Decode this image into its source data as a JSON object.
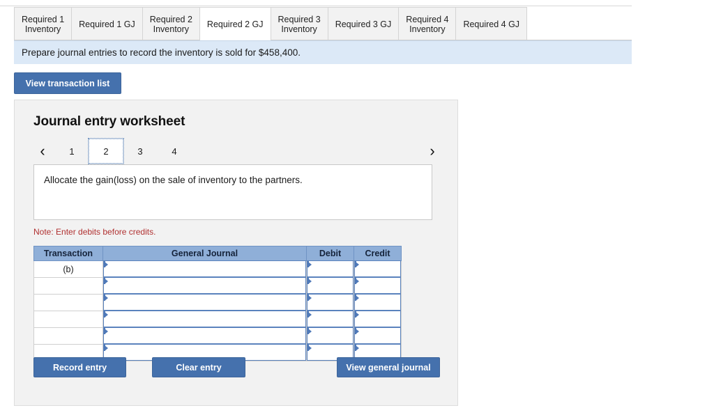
{
  "tabs": [
    {
      "line1": "Required 1",
      "line2": "Inventory",
      "active": false
    },
    {
      "line1": "Required 1 GJ",
      "line2": "",
      "active": false
    },
    {
      "line1": "Required 2",
      "line2": "Inventory",
      "active": false
    },
    {
      "line1": "Required 2 GJ",
      "line2": "",
      "active": true
    },
    {
      "line1": "Required 3",
      "line2": "Inventory",
      "active": false
    },
    {
      "line1": "Required 3 GJ",
      "line2": "",
      "active": false
    },
    {
      "line1": "Required 4",
      "line2": "Inventory",
      "active": false
    },
    {
      "line1": "Required 4 GJ",
      "line2": "",
      "active": false
    }
  ],
  "banner": {
    "text": "Prepare journal entries to record the inventory is sold for $458,400."
  },
  "toolbar": {
    "view_transaction_list_label": "View transaction list"
  },
  "worksheet": {
    "title": "Journal entry worksheet",
    "pager": {
      "prev_icon": "‹",
      "next_icon": "›",
      "pages": [
        "1",
        "2",
        "3",
        "4"
      ],
      "current": "2"
    },
    "description": "Allocate the gain(loss) on the sale of inventory to the partners.",
    "note": "Note: Enter debits before credits.",
    "table": {
      "headers": [
        "Transaction",
        "General Journal",
        "Debit",
        "Credit"
      ],
      "rows": [
        {
          "transaction": "(b)",
          "general_journal": "",
          "debit": "",
          "credit": ""
        },
        {
          "transaction": "",
          "general_journal": "",
          "debit": "",
          "credit": ""
        },
        {
          "transaction": "",
          "general_journal": "",
          "debit": "",
          "credit": ""
        },
        {
          "transaction": "",
          "general_journal": "",
          "debit": "",
          "credit": ""
        },
        {
          "transaction": "",
          "general_journal": "",
          "debit": "",
          "credit": ""
        },
        {
          "transaction": "",
          "general_journal": "",
          "debit": "",
          "credit": ""
        }
      ]
    },
    "buttons": {
      "record_entry": "Record entry",
      "clear_entry": "Clear entry",
      "view_general_journal": "View general journal"
    }
  },
  "colors": {
    "accent_blue": "#4571ad",
    "table_header_blue": "#8fafd8",
    "banner_blue": "#dce9f7",
    "panel_gray": "#f2f2f2",
    "note_red": "#b03030",
    "input_border_blue": "#5a82bd"
  }
}
